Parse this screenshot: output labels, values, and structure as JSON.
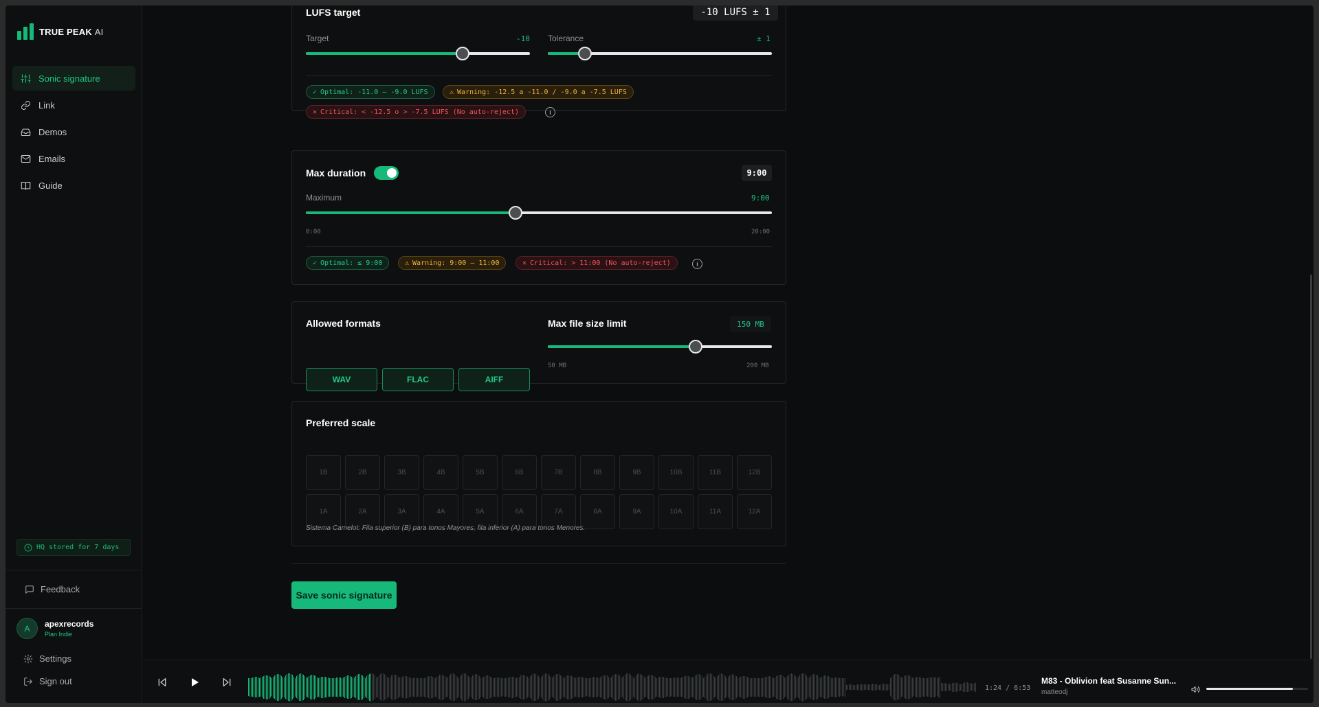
{
  "brand": {
    "name": "TRUE PEAK",
    "suffix": "AI",
    "color": "#16b97a"
  },
  "sidebar": {
    "items": [
      {
        "label": "Sonic signature",
        "icon": "sliders-icon",
        "active": true
      },
      {
        "label": "Link",
        "icon": "link-icon",
        "active": false
      },
      {
        "label": "Demos",
        "icon": "inbox-icon",
        "active": false
      },
      {
        "label": "Emails",
        "icon": "mail-icon",
        "active": false
      },
      {
        "label": "Guide",
        "icon": "book-icon",
        "active": false
      }
    ],
    "hq_badge": "HQ stored for 7 days",
    "feedback": "Feedback",
    "user": {
      "initial": "A",
      "name": "apexrecords",
      "plan": "Plan Indie"
    },
    "settings": "Settings",
    "sign_out": "Sign out"
  },
  "lufs": {
    "title": "LUFS target",
    "summary": "-10 LUFS ± 1",
    "target_label": "Target",
    "target_value": "-10",
    "target_fraction": 0.7,
    "tolerance_label": "Tolerance",
    "tolerance_value": "± 1",
    "tolerance_fraction": 0.165,
    "optimal": "Optimal: -11.0 — -9.0 LUFS",
    "warning": "Warning: -12.5 a -11.0 / -9.0 a -7.5 LUFS",
    "critical": "Critical: < -12.5 o > -7.5 LUFS (No auto-reject)"
  },
  "duration": {
    "title": "Max duration",
    "enabled": true,
    "summary": "9:00",
    "max_label": "Maximum",
    "max_value": "9:00",
    "fraction": 0.45,
    "min_tick": "0:00",
    "max_tick": "20:00",
    "optimal": "Optimal: ≤ 9:00",
    "warning": "Warning: 9:00 — 11:00",
    "critical": "Critical: > 11:00 (No auto-reject)"
  },
  "formats": {
    "title": "Allowed formats",
    "options": [
      "WAV",
      "FLAC",
      "AIFF"
    ],
    "size_title": "Max file size limit",
    "size_value": "150 MB",
    "size_fraction": 0.658,
    "size_min": "50 MB",
    "size_max": "200 MB"
  },
  "scale": {
    "title": "Preferred scale",
    "major": [
      "1B",
      "2B",
      "3B",
      "4B",
      "5B",
      "6B",
      "7B",
      "8B",
      "9B",
      "10B",
      "11B",
      "12B"
    ],
    "minor": [
      "1A",
      "2A",
      "3A",
      "4A",
      "5A",
      "6A",
      "7A",
      "8A",
      "9A",
      "10A",
      "11A",
      "12A"
    ],
    "note": "Sistema Camelot: Fila superior (B) para tonos Mayores, fila inferior (A) para tonos Menores."
  },
  "save_label": "Save sonic signature",
  "player": {
    "time": "1:24 / 6:53",
    "progress_fraction": 0.168,
    "title": "M83 - Oblivion feat Susanne Sun...",
    "artist": "matteodj",
    "volume_fraction": 0.85
  }
}
